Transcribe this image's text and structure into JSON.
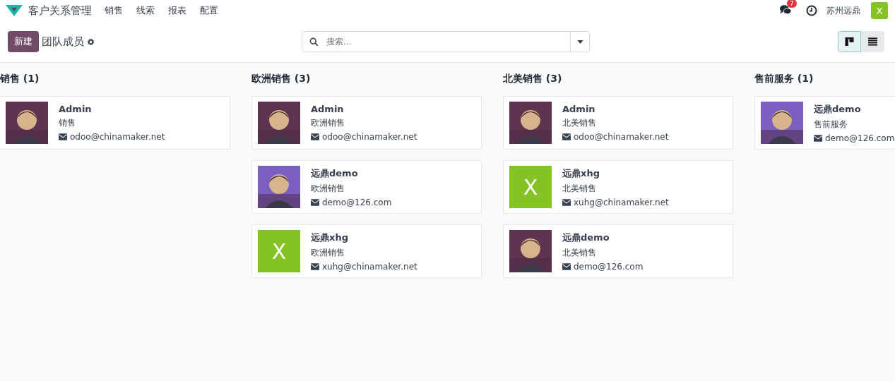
{
  "navbar": {
    "app_title": "客户关系管理",
    "menu": [
      "销售",
      "线索",
      "报表",
      "配置"
    ],
    "messages_badge": "7",
    "company": "苏州远鼎",
    "user_avatar": {
      "letter": "X",
      "color": "#84c225"
    }
  },
  "control_panel": {
    "new_button": "新建",
    "breadcrumb": "团队成员",
    "search": {
      "placeholder": "搜索..."
    },
    "views": [
      {
        "kind": "kanban",
        "selected": true
      },
      {
        "kind": "list",
        "selected": false
      }
    ]
  },
  "columns": [
    {
      "title": "销售 (1)",
      "cards": [
        {
          "name": "Admin",
          "team": "销售",
          "email": "odoo@chinamaker.net"
        }
      ]
    },
    {
      "title": "欧洲销售 (3)",
      "cards": [
        {
          "name": "Admin",
          "team": "欧洲销售",
          "email": "odoo@chinamaker.net"
        },
        {
          "name": "远鼎demo",
          "team": "欧洲销售",
          "email": "demo@126.com"
        },
        {
          "name": "远鼎xhg",
          "team": "欧洲销售",
          "email": "xuhg@chinamaker.net",
          "avatar": {
            "kind": "letter",
            "letter": "X",
            "color": "#84c225"
          }
        }
      ]
    },
    {
      "title": "北美销售 (3)",
      "cards": [
        {
          "name": "Admin",
          "team": "北美销售",
          "email": "odoo@chinamaker.net"
        },
        {
          "name": "远鼎xhg",
          "team": "北美销售",
          "email": "xuhg@chinamaker.net",
          "avatar": {
            "kind": "letter",
            "letter": "X",
            "color": "#84c225"
          }
        },
        {
          "name": "远鼎demo",
          "team": "北美销售",
          "email": "demo@126.com"
        }
      ]
    },
    {
      "title": "售前服务 (1)",
      "cards": [
        {
          "name": "远鼎demo",
          "team": "售前服务",
          "email": "demo@126.com"
        }
      ]
    }
  ]
}
